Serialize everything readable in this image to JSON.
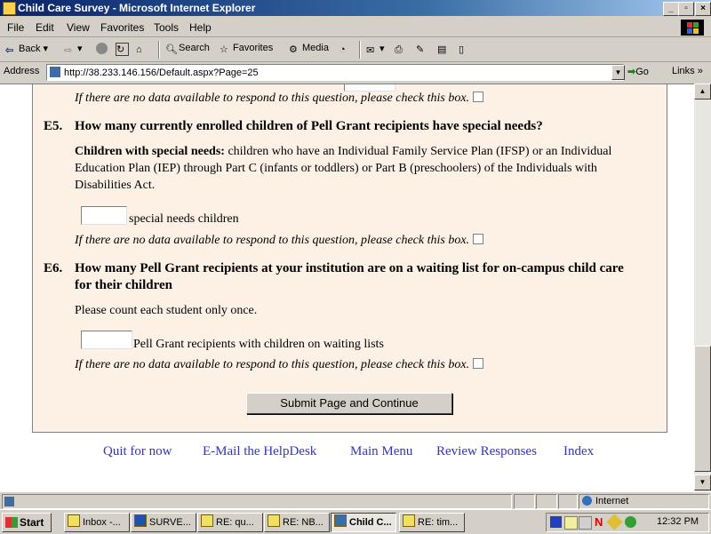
{
  "window": {
    "title": "Child Care Survey - Microsoft Internet Explorer"
  },
  "menu": [
    "File",
    "Edit",
    "View",
    "Favorites",
    "Tools",
    "Help"
  ],
  "toolbar": {
    "back": "Back",
    "search": "Search",
    "favorites": "Favorites",
    "media": "Media"
  },
  "address": {
    "label": "Address",
    "url": "http://38.233.146.156/Default.aspx?Page=25",
    "go": "Go",
    "links": "Links"
  },
  "survey": {
    "no_data_text": "If there are no data available to respond to this question, please check this box.",
    "e5": {
      "num": "E5.",
      "question": "How many currently enrolled children of Pell Grant recipients have special needs?",
      "def_bold": "Children with special needs:",
      "def_line1": "children who have an Individual Family Service Plan (IFSP) or an Individual",
      "def_line2": "Education Plan (IEP) through Part C (infants or toddlers) or Part B (preschoolers) of the Individuals with",
      "def_line3": "Disabilities Act.",
      "input_label": "special needs children"
    },
    "e6": {
      "num": "E6.",
      "question_line1": "How many Pell Grant recipients at your institution are on a waiting list for on-campus child care",
      "question_line2": "for their children",
      "instruction": "Please count each student only once.",
      "input_label": "Pell Grant recipients with children on waiting lists"
    },
    "submit": "Submit Page and Continue"
  },
  "footer_links": [
    "Quit for now",
    "E-Mail the HelpDesk",
    "Main Menu",
    "Review Responses",
    "Index"
  ],
  "status": {
    "zone": "Internet"
  },
  "taskbar": {
    "start": "Start",
    "tasks": [
      "Inbox -...",
      "SURVE...",
      "RE: qu...",
      "RE: NB...",
      "Child C...",
      "RE: tim..."
    ],
    "clock": "12:32 PM"
  }
}
